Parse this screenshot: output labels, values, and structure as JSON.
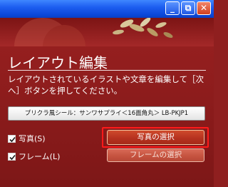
{
  "window": {
    "buttons": {
      "minimize": "_",
      "maximize": "⧉",
      "close": "✕"
    }
  },
  "page": {
    "title": "レイアウト編集",
    "description": "レイアウトされているイラストや文章を編集して［次へ］ボタンを押してください。"
  },
  "product_button": {
    "label": "プリクラ風シール：サンワサプライ＜16面角丸＞ LB-PKJP1"
  },
  "options": [
    {
      "label": "写真(S)",
      "checked": true,
      "button_label": "写真の選択",
      "button_enabled": true
    },
    {
      "label": "フレーム(L)",
      "checked": true,
      "button_label": "フレームの選択",
      "button_enabled": false
    }
  ],
  "colors": {
    "accent_highlight": "#ff1a1a",
    "panel_bg": "#8f1f1f",
    "titlebar": "#1d5ef0"
  }
}
